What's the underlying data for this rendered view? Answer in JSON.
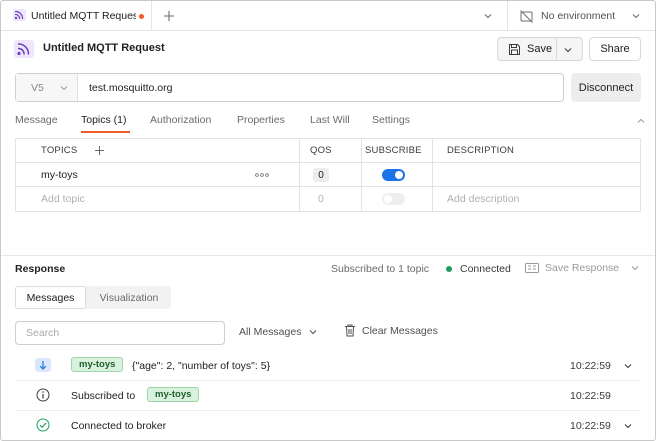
{
  "tabbar": {
    "tab_label": "Untitled MQTT Reques",
    "new_tab_icon": "plus-icon",
    "environment": "No environment"
  },
  "header": {
    "title": "Untitled MQTT Request",
    "save_label": "Save",
    "share_label": "Share"
  },
  "connection": {
    "version": "V5",
    "url": "test.mosquitto.org",
    "disconnect_label": "Disconnect"
  },
  "subtabs": [
    {
      "label": "Message"
    },
    {
      "label": "Topics (1)"
    },
    {
      "label": "Authorization"
    },
    {
      "label": "Properties"
    },
    {
      "label": "Last Will"
    },
    {
      "label": "Settings"
    }
  ],
  "topics_table": {
    "headers": {
      "topics": "TOPICS",
      "qos": "QOS",
      "subscribe": "SUBSCRIBE",
      "description": "DESCRIPTION"
    },
    "rows": [
      {
        "topic": "my-toys",
        "qos": "0",
        "subscribed": true,
        "description": ""
      }
    ],
    "new_row": {
      "topic_placeholder": "Add topic",
      "qos": "0",
      "description_placeholder": "Add description"
    }
  },
  "response": {
    "title": "Response",
    "status": "Subscribed to 1 topic",
    "connection_state": "Connected",
    "save_response_label": "Save Response",
    "view_tabs": [
      "Messages",
      "Visualization"
    ],
    "search_placeholder": "Search",
    "filter_label": "All Messages",
    "clear_label": "Clear Messages",
    "messages": [
      {
        "icon": "arrow-down-icon",
        "topic": "my-toys",
        "text": "{\"age\": 2, \"number of toys\": 5}",
        "time": "10:22:59",
        "expandable": true
      },
      {
        "icon": "info-icon",
        "text": "Subscribed to",
        "topic": "my-toys",
        "time": "10:22:59",
        "expandable": false
      },
      {
        "icon": "check-circle-icon",
        "text": "Connected to broker",
        "time": "10:22:59",
        "expandable": true
      }
    ]
  },
  "colors": {
    "accent": "#ef5b25",
    "toggle_on": "#1a73e8",
    "connected": "#1e9e5a",
    "tag_bg": "#d9f2de"
  }
}
